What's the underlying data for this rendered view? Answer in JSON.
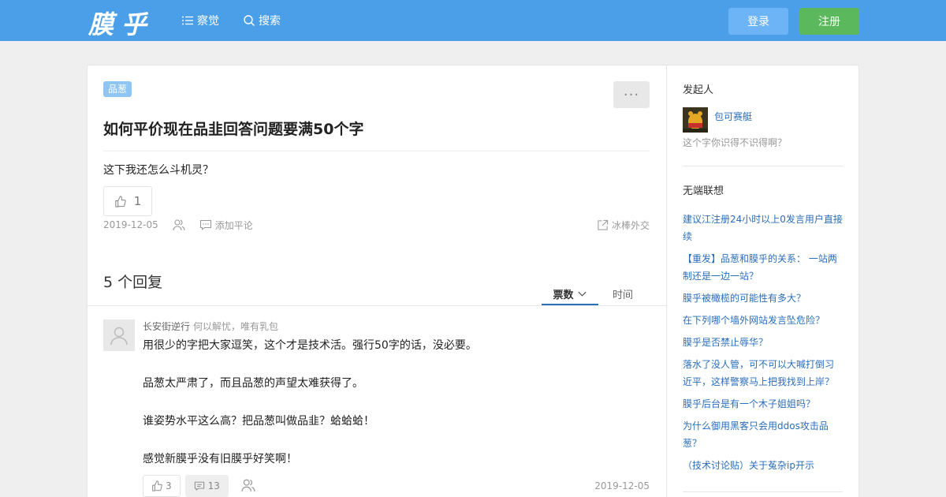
{
  "header": {
    "logo": "膜乎",
    "nav": [
      {
        "label": "察觉",
        "icon": "list-icon"
      },
      {
        "label": "搜索",
        "icon": "search-icon"
      }
    ],
    "login": "登录",
    "register": "注册"
  },
  "question": {
    "tag": "品葱",
    "more": "···",
    "title": "如何平价现在品韭回答问题要满50个字",
    "body": "这下我还怎么斗机灵？",
    "votes": "1",
    "date": "2019-12-05",
    "add_comment": "添加平论",
    "share": "冰棒外交"
  },
  "replies": {
    "count_label": "5 个回复",
    "sort_tabs": {
      "votes": "票数",
      "time": "时间"
    },
    "items": [
      {
        "author": "长安街逆行",
        "signature": "何以解忧，唯有乳包",
        "paragraphs": [
          "用很少的字把大家逗笑，这个才是技术活。强行50字的话，没必要。",
          "品葱太严肃了，而且品葱的声望太难获得了。",
          "谁姿势水平这么高？把品葱叫做品韭？蛤蛤蛤！",
          "感觉新膜乎没有旧膜乎好笑啊！"
        ],
        "votes": "3",
        "comments": "13",
        "date": "2019-12-05"
      }
    ]
  },
  "sidebar": {
    "starter_heading": "发起人",
    "starter_name": "包可赛艇",
    "starter_signature": "这个字你识得不识得啊？",
    "related_heading": "无端联想",
    "related": [
      "建议江注册24小时以上0发言用户直接续",
      "【重发】品葱和膜乎的关系： 一站两制还是一边一站？",
      "膜乎被橄榄的可能性有多大？",
      "在下列哪个墙外网站发言坠危险？",
      "膜乎是否禁止辱华？",
      "落水了没人管，可不可以大喊打倒习近平，这样警察马上把我找到上岸？",
      "膜乎后台是有一个木子姐姐吗？",
      "为什么御用黑客只会用ddos攻击品葱？",
      "（技术讨论贴）关于菟杂ip开示"
    ]
  },
  "colors": {
    "header_bg": "#4a9fe8",
    "register_bg": "#5cb85c",
    "login_bg": "#6cb4f5",
    "link": "#2a6ebb"
  }
}
